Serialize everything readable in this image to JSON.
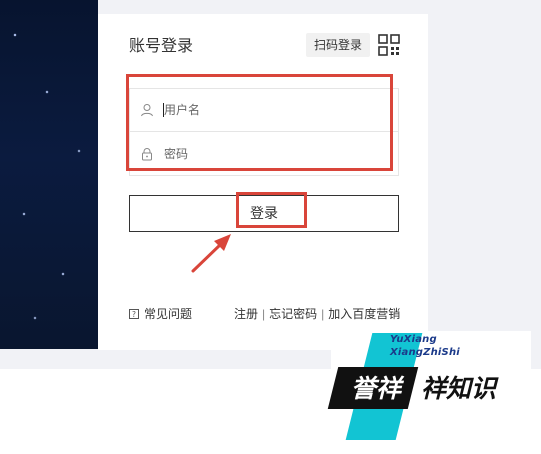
{
  "login_card": {
    "title": "账号登录",
    "scan_login_label": "扫码登录",
    "qr_icon": "qr-code-icon",
    "username": {
      "placeholder": "用户名",
      "value": "",
      "icon": "user-icon"
    },
    "password": {
      "placeholder": "密码",
      "value": "",
      "icon": "lock-icon"
    },
    "login_button_label": "登录"
  },
  "footer": {
    "faq_label": "常见问题",
    "faq_icon": "question-icon",
    "links": [
      "注册",
      "忘记密码",
      "加入百度营销"
    ],
    "separator": "|"
  },
  "watermark": {
    "english_line_1": "YuXiang",
    "english_line_2": "XiangZhiShi",
    "chinese_part_1": "誉祥",
    "chinese_part_2": "祥知识"
  },
  "annotations": {
    "highlight_color": "#d9453a",
    "arrow_icon": "arrow-icon"
  },
  "colors": {
    "background": "#f1f2f6",
    "accent_red": "#d9453a",
    "brand_teal": "#12c4d3",
    "dark_band": "#07142f"
  }
}
